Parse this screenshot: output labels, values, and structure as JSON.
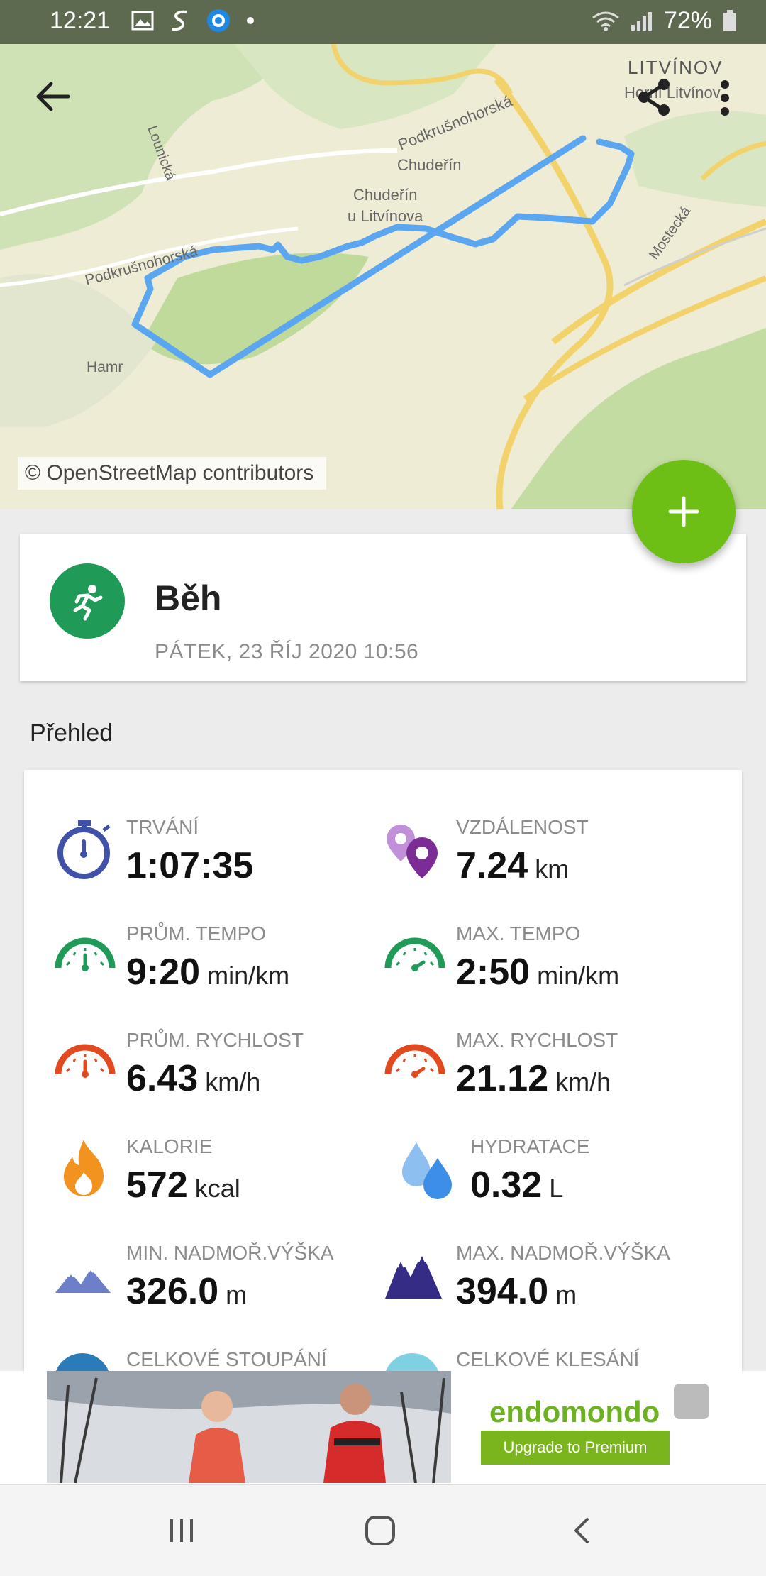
{
  "status_bar": {
    "time": "12:21",
    "battery": "72%"
  },
  "map": {
    "attribution": "© OpenStreetMap contributors",
    "labels": [
      "LITVÍNOV",
      "Horní Litvínov",
      "Podkrušnohorská",
      "Chudeřín",
      "Chudeřín",
      "u Litvínova",
      "Podkrušnohorská",
      "Lounická",
      "Hamr",
      "Mostecká"
    ]
  },
  "activity": {
    "name": "Běh",
    "date": "PÁTEK, 23 ŘÍJ 2020 10:56"
  },
  "section_title": "Přehled",
  "stats": [
    {
      "icon": "stopwatch-icon",
      "label": "TRVÁNÍ",
      "value": "1:07:35",
      "unit": ""
    },
    {
      "icon": "distance-pin-icon",
      "label": "VZDÁLENOST",
      "value": "7.24",
      "unit": "km"
    },
    {
      "icon": "avg-pace-gauge-icon",
      "label": "PRŮM. TEMPO",
      "value": "9:20",
      "unit": "min/km"
    },
    {
      "icon": "max-pace-gauge-icon",
      "label": "MAX. TEMPO",
      "value": "2:50",
      "unit": "min/km"
    },
    {
      "icon": "avg-speed-gauge-icon",
      "label": "PRŮM. RYCHLOST",
      "value": "6.43",
      "unit": "km/h"
    },
    {
      "icon": "max-speed-gauge-icon",
      "label": "MAX. RYCHLOST",
      "value": "21.12",
      "unit": "km/h"
    },
    {
      "icon": "flame-icon",
      "label": "KALORIE",
      "value": "572",
      "unit": "kcal"
    },
    {
      "icon": "water-drops-icon",
      "label": "HYDRATACE",
      "value": "0.32",
      "unit": "L"
    },
    {
      "icon": "mountain-min-icon",
      "label": "MIN. NADMOŘ.VÝŠKA",
      "value": "326.0",
      "unit": "m"
    },
    {
      "icon": "mountain-max-icon",
      "label": "MAX. NADMOŘ.VÝŠKA",
      "value": "394.0",
      "unit": "m"
    },
    {
      "icon": "ascent-icon",
      "label": "CELKOVÉ STOUPÁNÍ",
      "value": "",
      "unit": ""
    },
    {
      "icon": "descent-icon",
      "label": "CELKOVÉ KLESÁNÍ",
      "value": "",
      "unit": ""
    }
  ],
  "ad": {
    "brand": "endomondo",
    "button": "Upgrade to Premium"
  },
  "colors": {
    "fab": "#6dbe15",
    "activity_badge": "#1f9a57",
    "route": "#5aa6f0"
  }
}
